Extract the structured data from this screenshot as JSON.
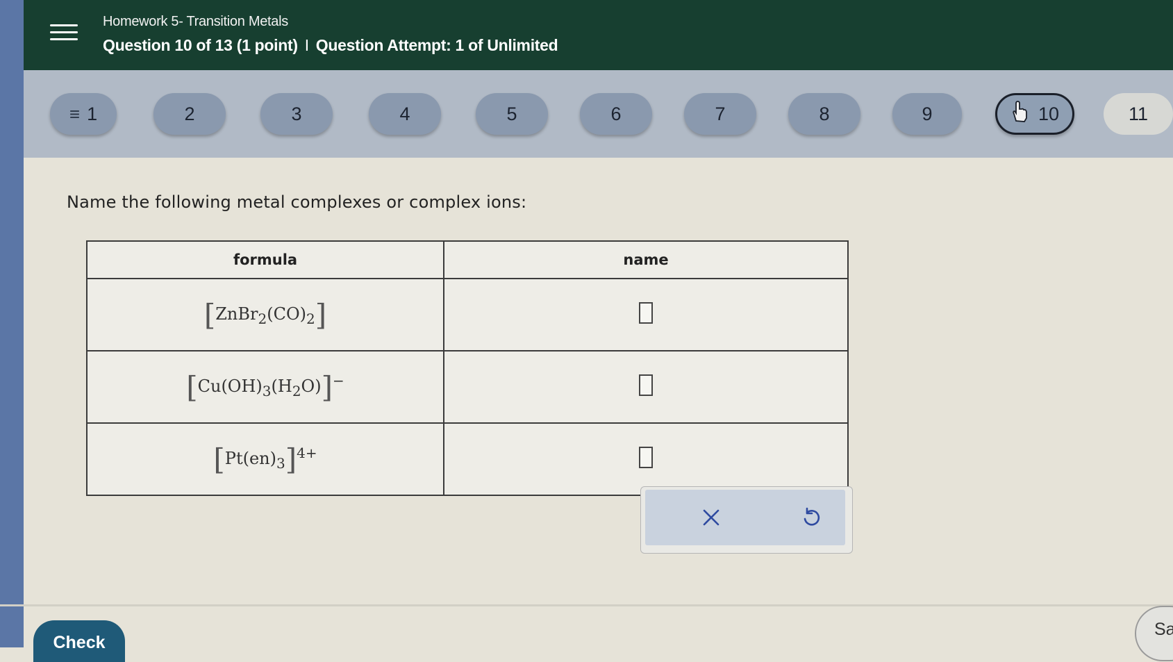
{
  "header": {
    "assignment_title": "Homework 5- Transition Metals",
    "question_label": "Question 10 of 13 (1 point)",
    "separator": "I",
    "attempt_label": "Question Attempt: 1 of Unlimited"
  },
  "question_nav": {
    "items": [
      {
        "label": "1"
      },
      {
        "label": "2"
      },
      {
        "label": "3"
      },
      {
        "label": "4"
      },
      {
        "label": "5"
      },
      {
        "label": "6"
      },
      {
        "label": "7"
      },
      {
        "label": "8"
      },
      {
        "label": "9"
      },
      {
        "label": "10"
      },
      {
        "label": "11"
      }
    ],
    "current": "10"
  },
  "question": {
    "prompt": "Name the following metal complexes or complex ions:"
  },
  "table": {
    "headers": {
      "formula": "formula",
      "name": "name"
    },
    "rows": [
      {
        "formula_core": "ZnBr",
        "sub1": "2",
        "group": "(CO)",
        "sub2": "2",
        "charge": "",
        "name_value": ""
      },
      {
        "formula_core": "Cu(OH)",
        "sub1": "3",
        "group": "(H",
        "sub_h": "2",
        "group_end": "O)",
        "charge": "−",
        "name_value": ""
      },
      {
        "formula_core": "Pt(en)",
        "sub1": "3",
        "charge": "4+",
        "name_value": ""
      }
    ]
  },
  "tools": {
    "clear_icon": "close-icon",
    "undo_icon": "undo-icon"
  },
  "actions": {
    "check_label": "Check",
    "save_label": "Sa"
  },
  "colors": {
    "header_bg": "#173f30",
    "nav_bg": "#b1bac6",
    "check_bg": "#1f5a78"
  }
}
